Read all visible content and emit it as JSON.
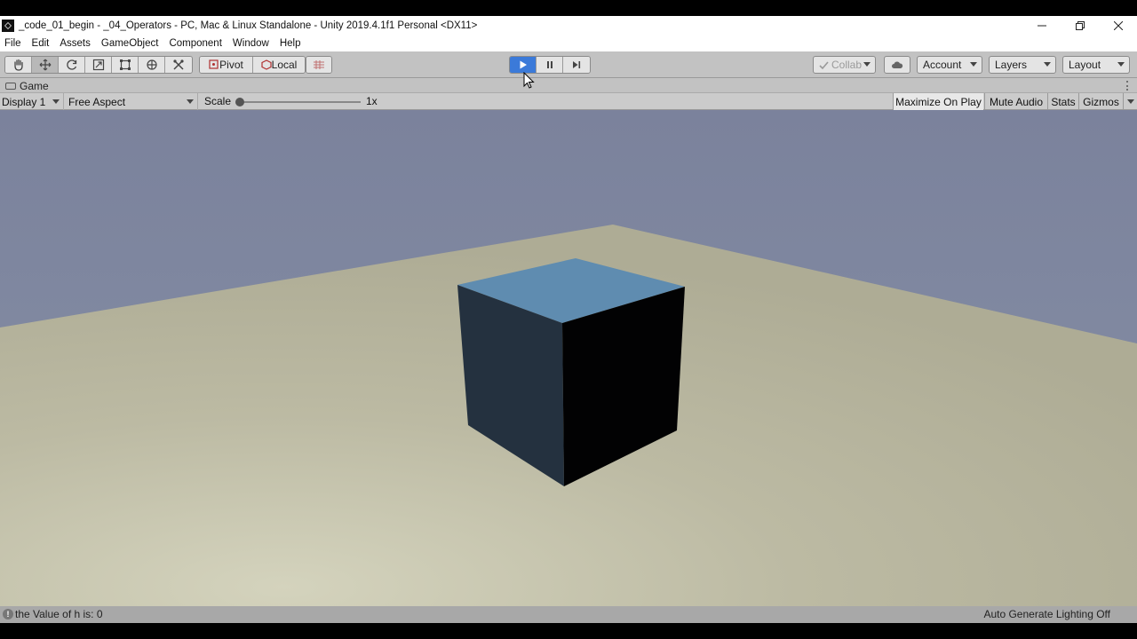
{
  "window": {
    "title": "_code_01_begin - _04_Operators - PC, Mac & Linux Standalone - Unity 2019.4.1f1 Personal <DX11>",
    "controls": [
      "minimize",
      "restore",
      "close"
    ]
  },
  "menu": {
    "items": [
      {
        "label": "File"
      },
      {
        "label": "Edit"
      },
      {
        "label": "Assets"
      },
      {
        "label": "GameObject"
      },
      {
        "label": "Component"
      },
      {
        "label": "Window"
      },
      {
        "label": "Help"
      }
    ]
  },
  "toolbar": {
    "tools": [
      {
        "name": "hand-tool",
        "icon": "hand-icon",
        "active": false
      },
      {
        "name": "move-tool",
        "icon": "move-icon",
        "active": true
      },
      {
        "name": "rotate-tool",
        "icon": "rotate-icon",
        "active": false
      },
      {
        "name": "scale-tool",
        "icon": "scale-icon",
        "active": false
      },
      {
        "name": "rect-tool",
        "icon": "rect-icon",
        "active": false
      },
      {
        "name": "transform-tool",
        "icon": "transform-icon",
        "active": false
      },
      {
        "name": "custom-tool",
        "icon": "custom-tool-icon",
        "active": false
      }
    ],
    "pivot_label": "Pivot",
    "local_label": "Local",
    "play_state": "playing",
    "collab_label": "Collab",
    "account_label": "Account",
    "layers_label": "Layers",
    "layout_label": "Layout",
    "accent_color": "#3b7ad9"
  },
  "game_tab": {
    "label": "Game"
  },
  "game_bar": {
    "display_label": "Display 1",
    "aspect_label": "Free Aspect",
    "scale_label": "Scale",
    "scale_value": "1x",
    "scale_fraction": 0,
    "maximize_label": "Maximize On Play",
    "mute_label": "Mute Audio",
    "stats_label": "Stats",
    "gizmos_label": "Gizmos"
  },
  "scene": {
    "sky_color": "#7b829c",
    "ground_color": "#b8b6a0",
    "cube_top_color": "#5f8cb0",
    "cube_left_color": "#24313f",
    "cube_right_color": "#020203"
  },
  "status": {
    "message": "the Value of h is: 0",
    "right_text": "Auto Generate Lighting Off"
  }
}
